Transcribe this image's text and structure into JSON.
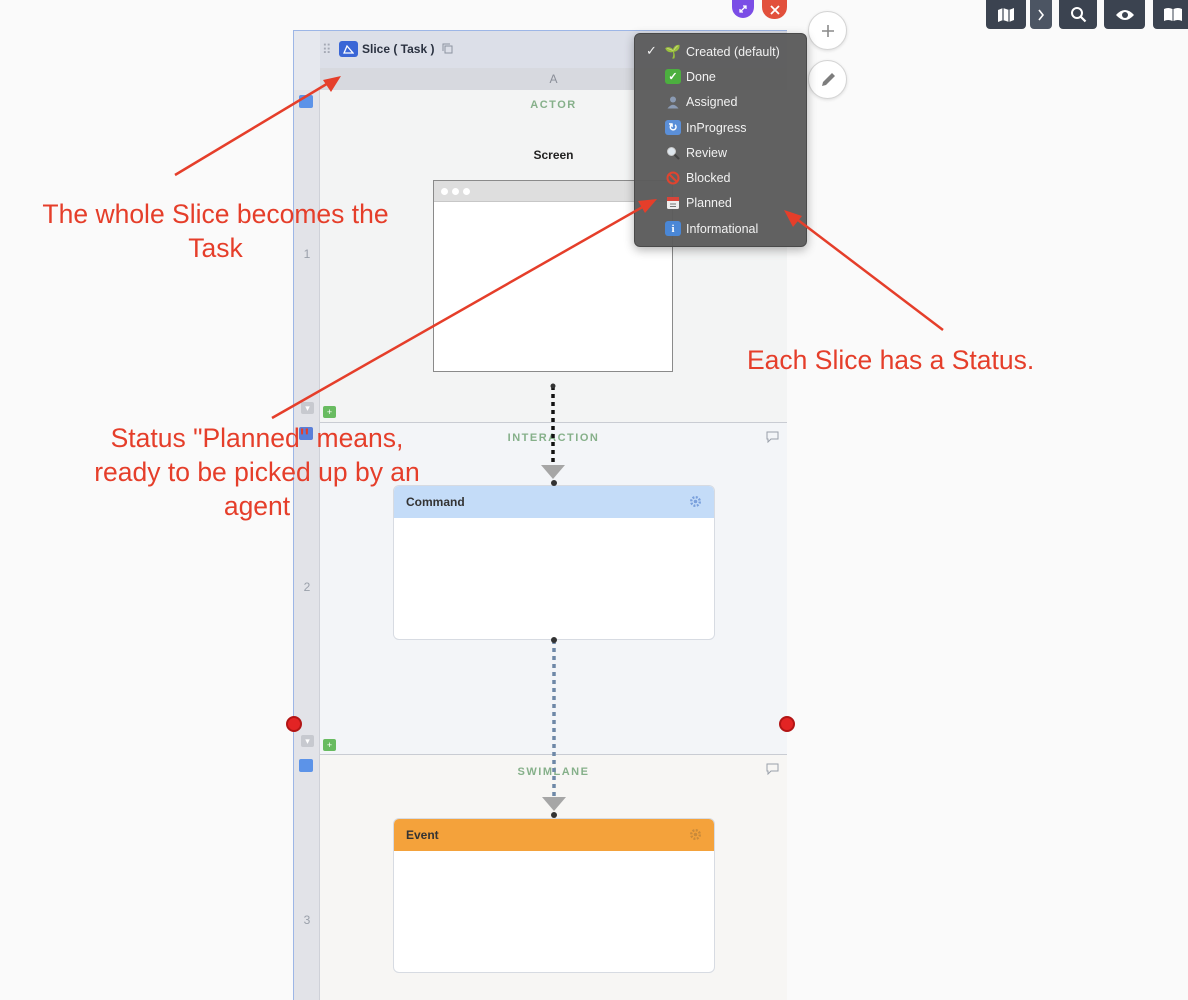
{
  "slice": {
    "title": "Slice ( Task )",
    "column_label": "A",
    "row_numbers": [
      "1",
      "2",
      "3"
    ]
  },
  "lanes": {
    "actor": {
      "title": "ACTOR",
      "screen_label": "Screen"
    },
    "interaction": {
      "title": "INTERACTION",
      "card_title": "Command"
    },
    "swimlane": {
      "title": "SWIMLANE",
      "card_title": "Event"
    }
  },
  "status_menu": {
    "selected": "Created (default)",
    "items": [
      {
        "label": "Created (default)",
        "icon": "seedling-icon"
      },
      {
        "label": "Done",
        "icon": "check-box-icon"
      },
      {
        "label": "Assigned",
        "icon": "person-icon"
      },
      {
        "label": "InProgress",
        "icon": "refresh-icon"
      },
      {
        "label": "Review",
        "icon": "magnifier-icon"
      },
      {
        "label": "Blocked",
        "icon": "prohibited-icon"
      },
      {
        "label": "Planned",
        "icon": "calendar-icon"
      },
      {
        "label": "Informational",
        "icon": "info-icon"
      }
    ]
  },
  "annotations": {
    "task": "The whole Slice becomes the Task",
    "planned": "Status \"Planned\" means, ready to be picked up by an agent",
    "status": "Each Slice has a Status."
  },
  "colors": {
    "command": "#c4dcf8",
    "event": "#f4a23b",
    "annotation": "#e53e2a",
    "menu_bg": "#5c5c5c",
    "toolbar": "#3b4350"
  }
}
